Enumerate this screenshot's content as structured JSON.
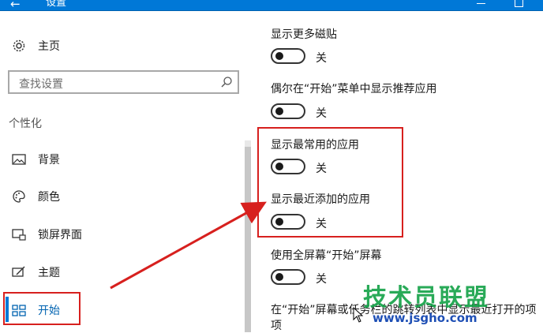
{
  "window": {
    "title": "设置",
    "back_icon": "arrow-left-icon",
    "accent_color": "#0078d7"
  },
  "sidebar": {
    "home_label": "主页",
    "search_placeholder": "查找设置",
    "section_label": "个性化",
    "items": [
      {
        "label": "背景",
        "icon": "picture-icon"
      },
      {
        "label": "颜色",
        "icon": "palette-icon"
      },
      {
        "label": "锁屏界面",
        "icon": "lock-screen-icon"
      },
      {
        "label": "主题",
        "icon": "theme-icon"
      },
      {
        "label": "开始",
        "icon": "start-icon",
        "active": true
      }
    ]
  },
  "settings": [
    {
      "title": "显示更多磁贴",
      "state": "关"
    },
    {
      "title": "偶尔在“开始”菜单中显示推荐应用",
      "state": "关"
    },
    {
      "title": "显示最常用的应用",
      "state": "关"
    },
    {
      "title": "显示最近添加的应用",
      "state": "关"
    },
    {
      "title": "使用全屏幕“开始”屏幕",
      "state": "关"
    },
    {
      "title": "在“开始”屏幕或任务栏的跳转列表中显示最近打开的项",
      "line2": "项"
    }
  ],
  "annotations": {
    "highlight_color": "#d7201e"
  },
  "watermark": {
    "title": "技术员联盟",
    "url": "www.jsgho.com"
  }
}
